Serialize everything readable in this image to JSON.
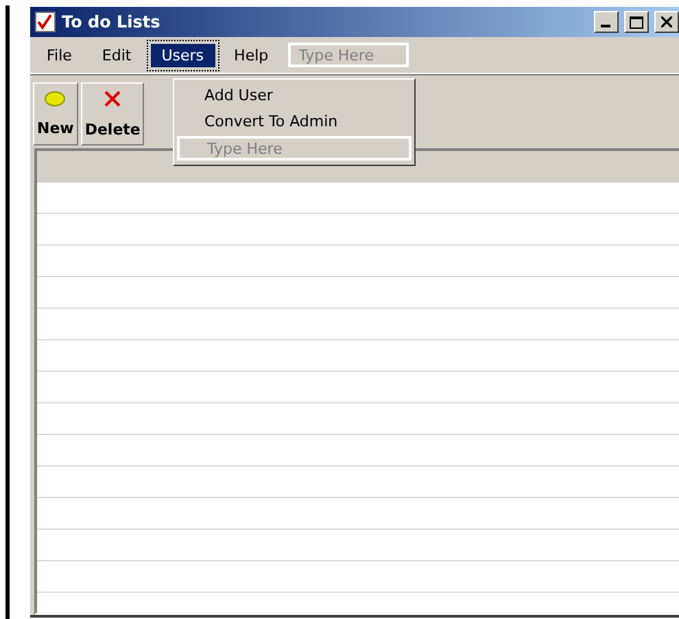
{
  "window": {
    "title": "To do Lists"
  },
  "menu": [
    {
      "label": "File",
      "selected": false
    },
    {
      "label": "Edit",
      "selected": false
    },
    {
      "label": "Users",
      "selected": true
    },
    {
      "label": "Help",
      "selected": false
    }
  ],
  "menu_new_item": {
    "placeholder": "Type Here"
  },
  "dropdown": {
    "items": [
      "Add User",
      "Convert To Admin"
    ],
    "new_item": {
      "placeholder": "Type Here"
    }
  },
  "toolbar": [
    {
      "label": "New",
      "kind": "new"
    },
    {
      "label": "Delete",
      "kind": "delete"
    }
  ]
}
